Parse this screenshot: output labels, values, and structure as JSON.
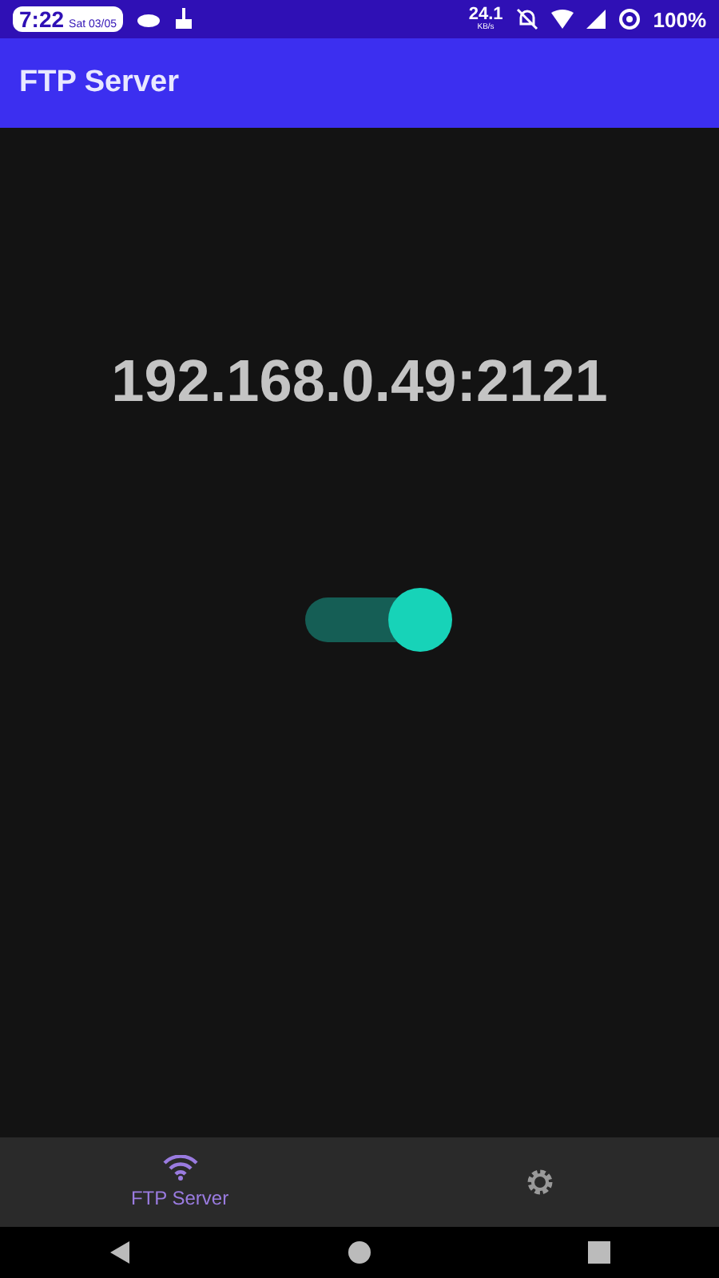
{
  "status_bar": {
    "time": "7:22",
    "date": "Sat 03/05",
    "speed": "24.1",
    "speed_unit": "KB/s",
    "battery": "100%"
  },
  "app_bar": {
    "title": "FTP Server"
  },
  "server": {
    "address": "192.168.0.49:2121",
    "on": true
  },
  "bottom_nav": [
    {
      "kind": "wifi",
      "label": "FTP Server",
      "selected": true
    },
    {
      "kind": "gear",
      "selected": false
    }
  ]
}
